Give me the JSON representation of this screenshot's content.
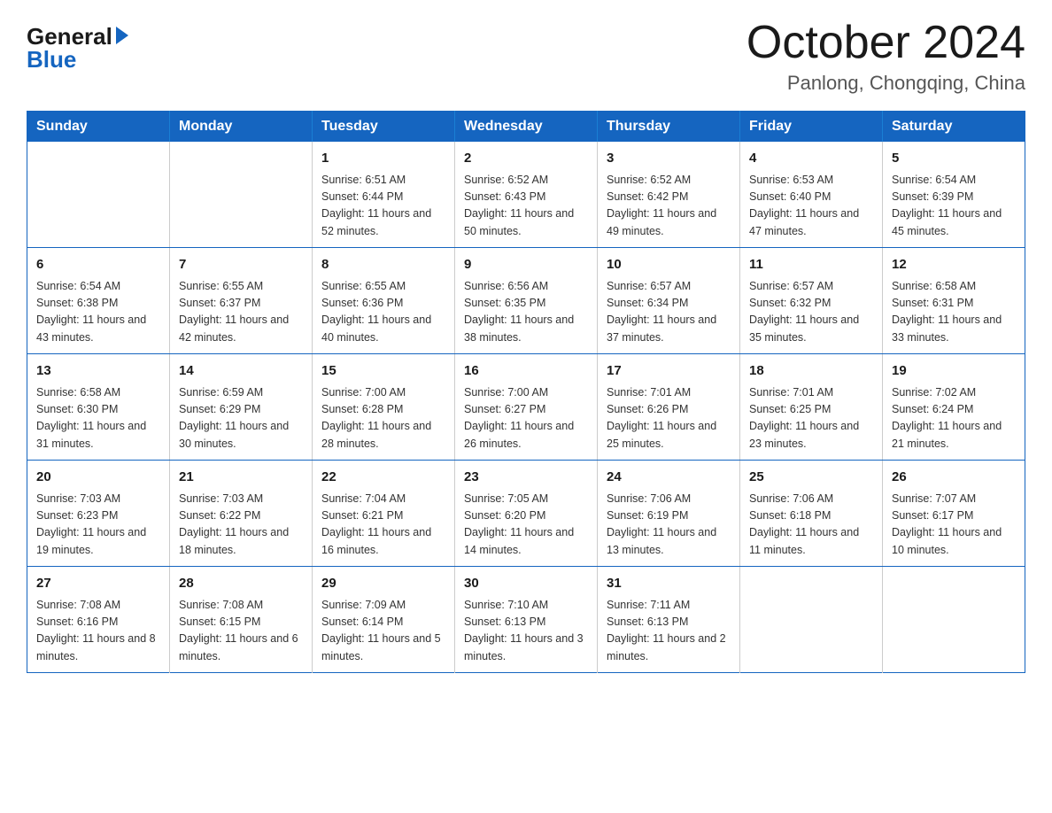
{
  "logo": {
    "general": "General",
    "blue": "Blue"
  },
  "header": {
    "month_year": "October 2024",
    "location": "Panlong, Chongqing, China"
  },
  "days_of_week": [
    "Sunday",
    "Monday",
    "Tuesday",
    "Wednesday",
    "Thursday",
    "Friday",
    "Saturday"
  ],
  "weeks": [
    [
      {
        "day": "",
        "sunrise": "",
        "sunset": "",
        "daylight": ""
      },
      {
        "day": "",
        "sunrise": "",
        "sunset": "",
        "daylight": ""
      },
      {
        "day": "1",
        "sunrise": "Sunrise: 6:51 AM",
        "sunset": "Sunset: 6:44 PM",
        "daylight": "Daylight: 11 hours and 52 minutes."
      },
      {
        "day": "2",
        "sunrise": "Sunrise: 6:52 AM",
        "sunset": "Sunset: 6:43 PM",
        "daylight": "Daylight: 11 hours and 50 minutes."
      },
      {
        "day": "3",
        "sunrise": "Sunrise: 6:52 AM",
        "sunset": "Sunset: 6:42 PM",
        "daylight": "Daylight: 11 hours and 49 minutes."
      },
      {
        "day": "4",
        "sunrise": "Sunrise: 6:53 AM",
        "sunset": "Sunset: 6:40 PM",
        "daylight": "Daylight: 11 hours and 47 minutes."
      },
      {
        "day": "5",
        "sunrise": "Sunrise: 6:54 AM",
        "sunset": "Sunset: 6:39 PM",
        "daylight": "Daylight: 11 hours and 45 minutes."
      }
    ],
    [
      {
        "day": "6",
        "sunrise": "Sunrise: 6:54 AM",
        "sunset": "Sunset: 6:38 PM",
        "daylight": "Daylight: 11 hours and 43 minutes."
      },
      {
        "day": "7",
        "sunrise": "Sunrise: 6:55 AM",
        "sunset": "Sunset: 6:37 PM",
        "daylight": "Daylight: 11 hours and 42 minutes."
      },
      {
        "day": "8",
        "sunrise": "Sunrise: 6:55 AM",
        "sunset": "Sunset: 6:36 PM",
        "daylight": "Daylight: 11 hours and 40 minutes."
      },
      {
        "day": "9",
        "sunrise": "Sunrise: 6:56 AM",
        "sunset": "Sunset: 6:35 PM",
        "daylight": "Daylight: 11 hours and 38 minutes."
      },
      {
        "day": "10",
        "sunrise": "Sunrise: 6:57 AM",
        "sunset": "Sunset: 6:34 PM",
        "daylight": "Daylight: 11 hours and 37 minutes."
      },
      {
        "day": "11",
        "sunrise": "Sunrise: 6:57 AM",
        "sunset": "Sunset: 6:32 PM",
        "daylight": "Daylight: 11 hours and 35 minutes."
      },
      {
        "day": "12",
        "sunrise": "Sunrise: 6:58 AM",
        "sunset": "Sunset: 6:31 PM",
        "daylight": "Daylight: 11 hours and 33 minutes."
      }
    ],
    [
      {
        "day": "13",
        "sunrise": "Sunrise: 6:58 AM",
        "sunset": "Sunset: 6:30 PM",
        "daylight": "Daylight: 11 hours and 31 minutes."
      },
      {
        "day": "14",
        "sunrise": "Sunrise: 6:59 AM",
        "sunset": "Sunset: 6:29 PM",
        "daylight": "Daylight: 11 hours and 30 minutes."
      },
      {
        "day": "15",
        "sunrise": "Sunrise: 7:00 AM",
        "sunset": "Sunset: 6:28 PM",
        "daylight": "Daylight: 11 hours and 28 minutes."
      },
      {
        "day": "16",
        "sunrise": "Sunrise: 7:00 AM",
        "sunset": "Sunset: 6:27 PM",
        "daylight": "Daylight: 11 hours and 26 minutes."
      },
      {
        "day": "17",
        "sunrise": "Sunrise: 7:01 AM",
        "sunset": "Sunset: 6:26 PM",
        "daylight": "Daylight: 11 hours and 25 minutes."
      },
      {
        "day": "18",
        "sunrise": "Sunrise: 7:01 AM",
        "sunset": "Sunset: 6:25 PM",
        "daylight": "Daylight: 11 hours and 23 minutes."
      },
      {
        "day": "19",
        "sunrise": "Sunrise: 7:02 AM",
        "sunset": "Sunset: 6:24 PM",
        "daylight": "Daylight: 11 hours and 21 minutes."
      }
    ],
    [
      {
        "day": "20",
        "sunrise": "Sunrise: 7:03 AM",
        "sunset": "Sunset: 6:23 PM",
        "daylight": "Daylight: 11 hours and 19 minutes."
      },
      {
        "day": "21",
        "sunrise": "Sunrise: 7:03 AM",
        "sunset": "Sunset: 6:22 PM",
        "daylight": "Daylight: 11 hours and 18 minutes."
      },
      {
        "day": "22",
        "sunrise": "Sunrise: 7:04 AM",
        "sunset": "Sunset: 6:21 PM",
        "daylight": "Daylight: 11 hours and 16 minutes."
      },
      {
        "day": "23",
        "sunrise": "Sunrise: 7:05 AM",
        "sunset": "Sunset: 6:20 PM",
        "daylight": "Daylight: 11 hours and 14 minutes."
      },
      {
        "day": "24",
        "sunrise": "Sunrise: 7:06 AM",
        "sunset": "Sunset: 6:19 PM",
        "daylight": "Daylight: 11 hours and 13 minutes."
      },
      {
        "day": "25",
        "sunrise": "Sunrise: 7:06 AM",
        "sunset": "Sunset: 6:18 PM",
        "daylight": "Daylight: 11 hours and 11 minutes."
      },
      {
        "day": "26",
        "sunrise": "Sunrise: 7:07 AM",
        "sunset": "Sunset: 6:17 PM",
        "daylight": "Daylight: 11 hours and 10 minutes."
      }
    ],
    [
      {
        "day": "27",
        "sunrise": "Sunrise: 7:08 AM",
        "sunset": "Sunset: 6:16 PM",
        "daylight": "Daylight: 11 hours and 8 minutes."
      },
      {
        "day": "28",
        "sunrise": "Sunrise: 7:08 AM",
        "sunset": "Sunset: 6:15 PM",
        "daylight": "Daylight: 11 hours and 6 minutes."
      },
      {
        "day": "29",
        "sunrise": "Sunrise: 7:09 AM",
        "sunset": "Sunset: 6:14 PM",
        "daylight": "Daylight: 11 hours and 5 minutes."
      },
      {
        "day": "30",
        "sunrise": "Sunrise: 7:10 AM",
        "sunset": "Sunset: 6:13 PM",
        "daylight": "Daylight: 11 hours and 3 minutes."
      },
      {
        "day": "31",
        "sunrise": "Sunrise: 7:11 AM",
        "sunset": "Sunset: 6:13 PM",
        "daylight": "Daylight: 11 hours and 2 minutes."
      },
      {
        "day": "",
        "sunrise": "",
        "sunset": "",
        "daylight": ""
      },
      {
        "day": "",
        "sunrise": "",
        "sunset": "",
        "daylight": ""
      }
    ]
  ]
}
